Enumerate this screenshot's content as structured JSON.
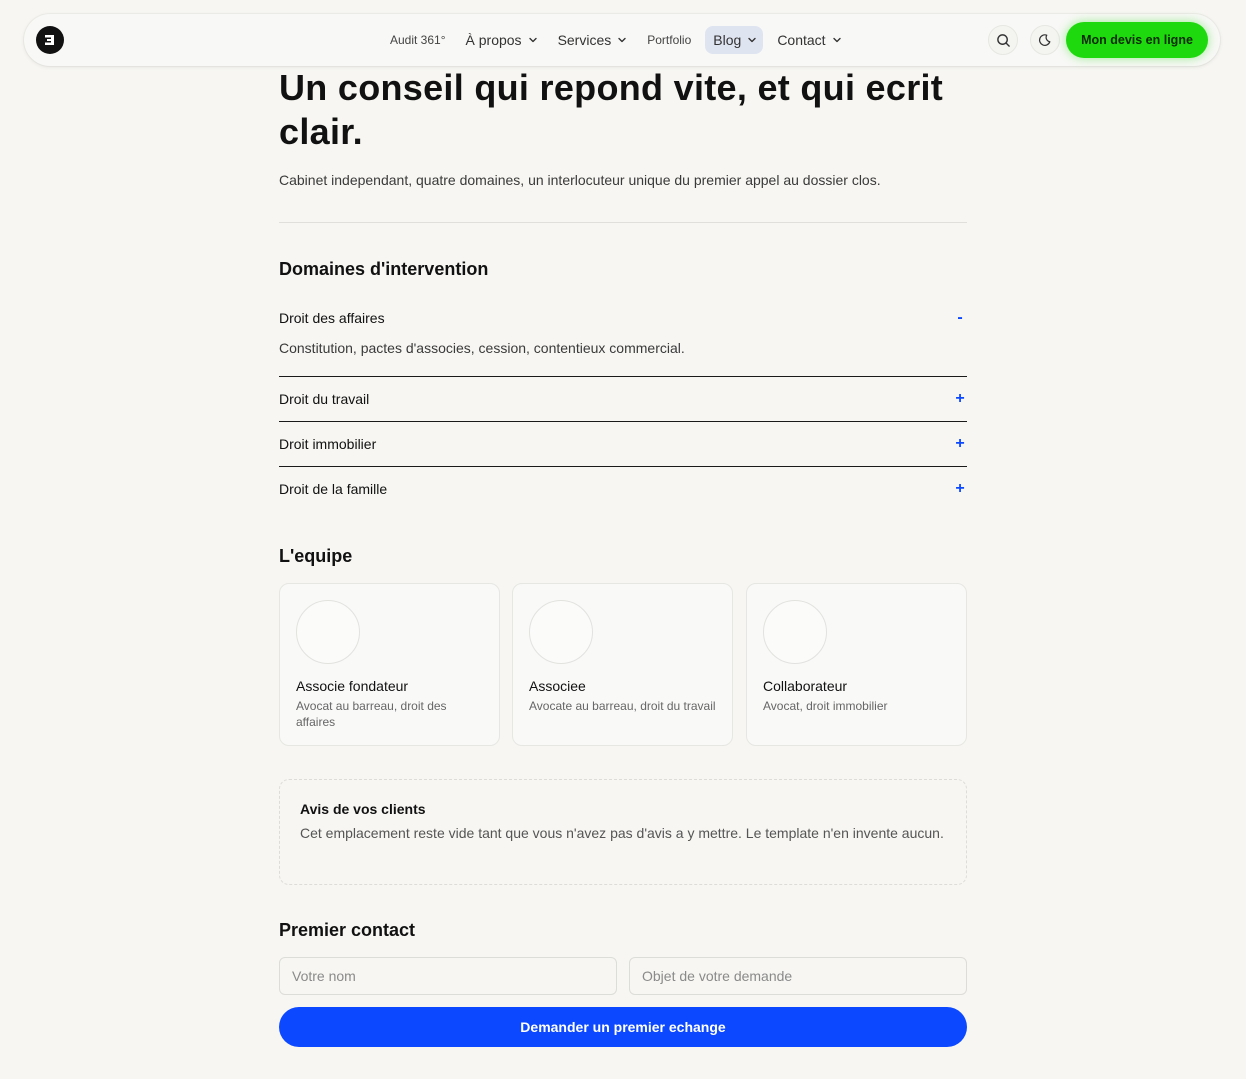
{
  "nav": {
    "items": [
      {
        "label": "Audit 361°",
        "dropdown": false,
        "small": true
      },
      {
        "label": "À propos",
        "dropdown": true
      },
      {
        "label": "Services",
        "dropdown": true
      },
      {
        "label": "Portfolio",
        "dropdown": false,
        "small": true
      },
      {
        "label": "Blog",
        "dropdown": true,
        "active": true
      },
      {
        "label": "Contact",
        "dropdown": true
      }
    ],
    "cta_label": "Mon devis en ligne"
  },
  "hero": {
    "title": "Un conseil qui repond vite, et qui ecrit clair.",
    "subtitle": "Cabinet independant, quatre domaines, un interlocuteur unique du premier appel au dossier clos."
  },
  "domains": {
    "title": "Domaines d'intervention",
    "items": [
      {
        "label": "Droit des affaires",
        "toggle": "-",
        "body": "Constitution, pactes d'associes, cession, contentieux commercial."
      },
      {
        "label": "Droit du travail",
        "toggle": "+"
      },
      {
        "label": "Droit immobilier",
        "toggle": "+"
      },
      {
        "label": "Droit de la famille",
        "toggle": "+"
      }
    ]
  },
  "team": {
    "title": "L'equipe",
    "members": [
      {
        "name": "Associe fondateur",
        "role": "Avocat au barreau, droit des affaires"
      },
      {
        "name": "Associee",
        "role": "Avocate au barreau, droit du travail"
      },
      {
        "name": "Collaborateur",
        "role": "Avocat, droit immobilier"
      }
    ]
  },
  "reviews": {
    "title": "Avis de vos clients",
    "text": "Cet emplacement reste vide tant que vous n'avez pas d'avis a y mettre. Le template n'en invente aucun."
  },
  "contact": {
    "title": "Premier contact",
    "name_placeholder": "Votre nom",
    "subject_placeholder": "Objet de votre demande",
    "submit_label": "Demander un premier echange"
  },
  "colors": {
    "accent": "#0b48ff",
    "cta": "#1fd90f",
    "background": "#f7f6f2"
  }
}
